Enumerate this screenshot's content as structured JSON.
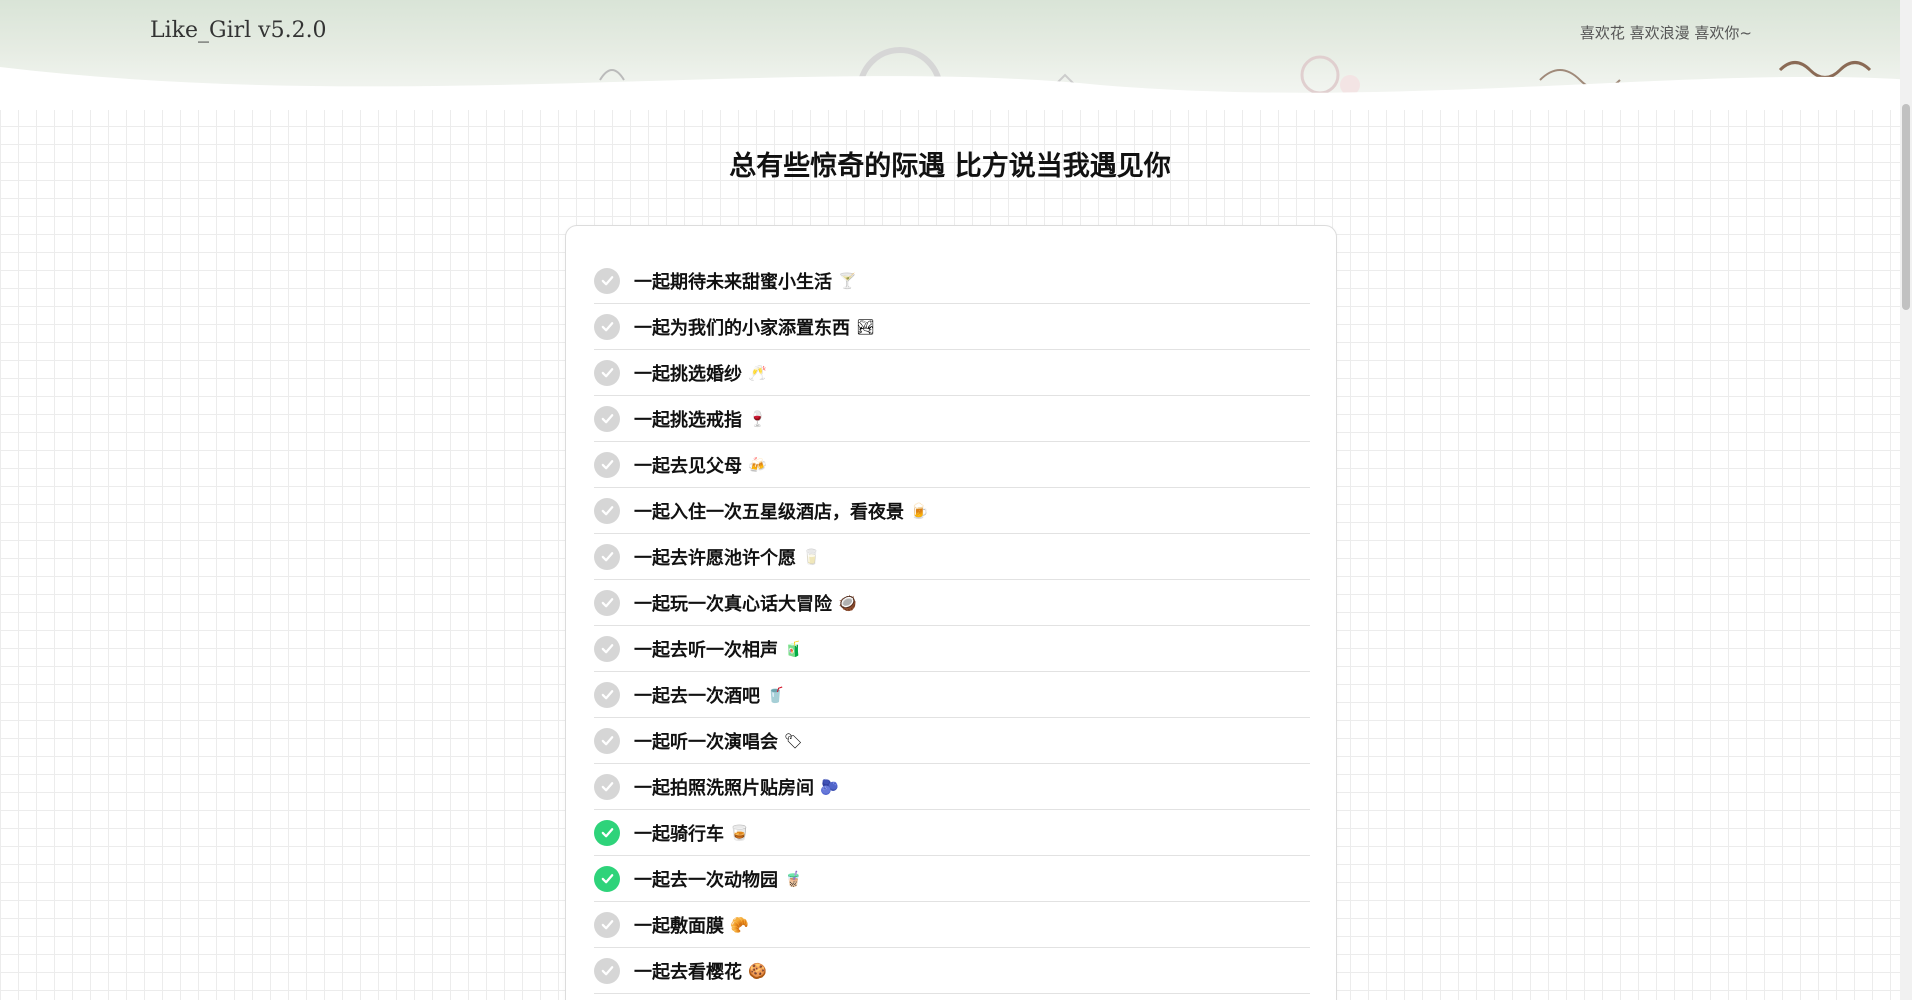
{
  "header": {
    "brand": "Like_Girl v5.2.0",
    "tagline": "喜欢花 喜欢浪漫 喜欢你~"
  },
  "page_title": "总有些惊奇的际遇 比方说当我遇见你",
  "colors": {
    "done": "#2ed37a",
    "pending": "#d6d6d6",
    "header_bg": "#dfe8dd"
  },
  "items": [
    {
      "text": "一起期待未来甜蜜小生活",
      "emoji": "🍸",
      "done": false
    },
    {
      "text": "一起为我们的小家添置东西",
      "emoji": "🏞",
      "done": false
    },
    {
      "text": "一起挑选婚纱",
      "emoji": "🥂",
      "done": false
    },
    {
      "text": "一起挑选戒指",
      "emoji": "🍷",
      "done": false
    },
    {
      "text": "一起去见父母",
      "emoji": "🍻",
      "done": false
    },
    {
      "text": "一起入住一次五星级酒店，看夜景",
      "emoji": "🍺",
      "done": false
    },
    {
      "text": "一起去许愿池许个愿",
      "emoji": "🥛",
      "done": false
    },
    {
      "text": "一起玩一次真心话大冒险",
      "emoji": "🥥",
      "done": false
    },
    {
      "text": "一起去听一次相声",
      "emoji": "🧃",
      "done": false
    },
    {
      "text": "一起去一次酒吧",
      "emoji": "🥤",
      "done": false
    },
    {
      "text": "一起听一次演唱会",
      "emoji": "🏷",
      "done": false
    },
    {
      "text": "一起拍照洗照片贴房间",
      "emoji": "🫐",
      "done": false
    },
    {
      "text": "一起骑行车",
      "emoji": "🥃",
      "done": true
    },
    {
      "text": "一起去一次动物园",
      "emoji": "🧋",
      "done": true
    },
    {
      "text": "一起敷面膜",
      "emoji": "🥐",
      "done": false
    },
    {
      "text": "一起去看樱花",
      "emoji": "🍪",
      "done": false
    },
    {
      "text": "",
      "emoji": "",
      "done": false
    }
  ]
}
